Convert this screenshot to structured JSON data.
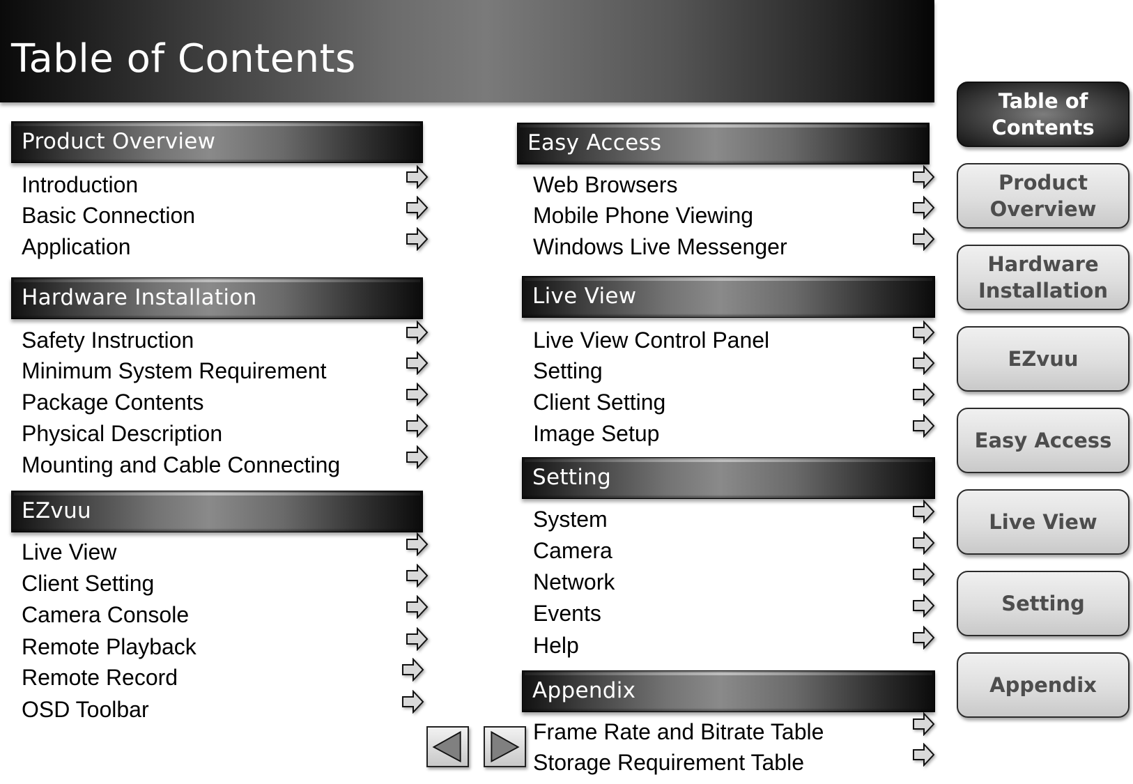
{
  "header": {
    "title": "Table of Contents"
  },
  "sections": {
    "product_overview": {
      "title": "Product Overview",
      "items": [
        "Introduction",
        "Basic Connection",
        "Application"
      ]
    },
    "hardware_installation": {
      "title": "Hardware Installation",
      "items": [
        "Safety Instruction",
        "Minimum System Requirement",
        "Package Contents",
        "Physical Description",
        "Mounting and Cable Connecting"
      ]
    },
    "ezvuu": {
      "title": "EZvuu",
      "items": [
        "Live View",
        "Client Setting",
        "Camera Console",
        "Remote Playback",
        "Remote Record",
        "OSD Toolbar"
      ]
    },
    "easy_access": {
      "title": "Easy Access",
      "items": [
        "Web Browsers",
        "Mobile Phone Viewing",
        "Windows Live Messenger"
      ]
    },
    "live_view": {
      "title": "Live View",
      "items": [
        "Live View Control Panel",
        "Setting",
        "Client Setting",
        "Image Setup"
      ]
    },
    "setting": {
      "title": "Setting",
      "items": [
        "System",
        "Camera",
        "Network",
        "Events",
        "Help"
      ]
    },
    "appendix": {
      "title": "Appendix",
      "items": [
        "Frame Rate and Bitrate Table",
        "Storage Requirement Table"
      ]
    }
  },
  "sidebar": {
    "items": [
      {
        "label": "Table of\nContents",
        "active": true
      },
      {
        "label": "Product\nOverview",
        "active": false
      },
      {
        "label": "Hardware\nInstallation",
        "active": false
      },
      {
        "label": "EZvuu",
        "active": false
      },
      {
        "label": "Easy Access",
        "active": false
      },
      {
        "label": "Live View",
        "active": false
      },
      {
        "label": "Setting",
        "active": false
      },
      {
        "label": "Appendix",
        "active": false
      }
    ]
  },
  "nav": {
    "prev_icon": "triangle-left-icon",
    "next_icon": "triangle-right-icon"
  },
  "icons": {
    "item_link": "outline-right-arrow-icon"
  },
  "colors": {
    "arrow_fill": "#d9d9d9",
    "nav_triangle": "#808080",
    "sidebar_text": "#4d4d4d"
  }
}
